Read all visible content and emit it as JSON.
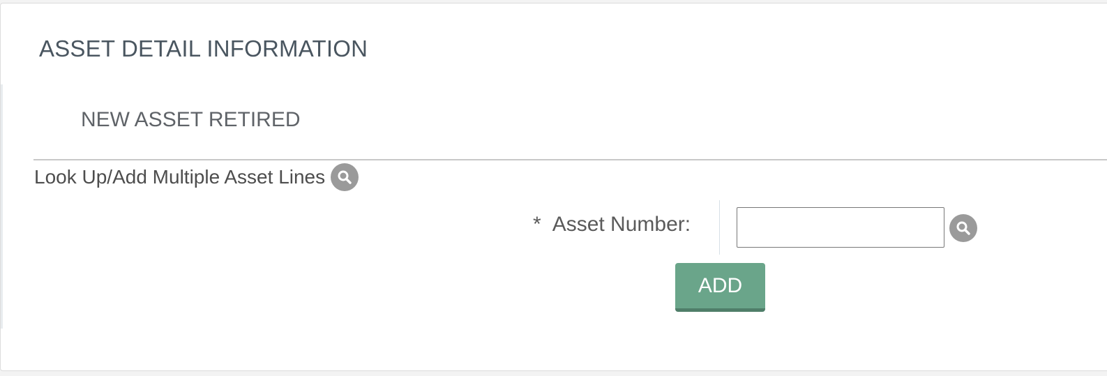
{
  "panel": {
    "title": "ASSET DETAIL INFORMATION",
    "section_title": "NEW ASSET RETIRED"
  },
  "lookup": {
    "label": "Look Up/Add Multiple Asset Lines",
    "icon": "search-icon"
  },
  "asset_field": {
    "required_marker": "*",
    "label": "Asset Number:",
    "value": "",
    "placeholder": "",
    "icon": "search-icon"
  },
  "actions": {
    "add_label": "ADD"
  },
  "colors": {
    "add_button": "#6aa58a",
    "search_icon_bg": "#9a9a9a",
    "title_text": "#4a5660"
  }
}
